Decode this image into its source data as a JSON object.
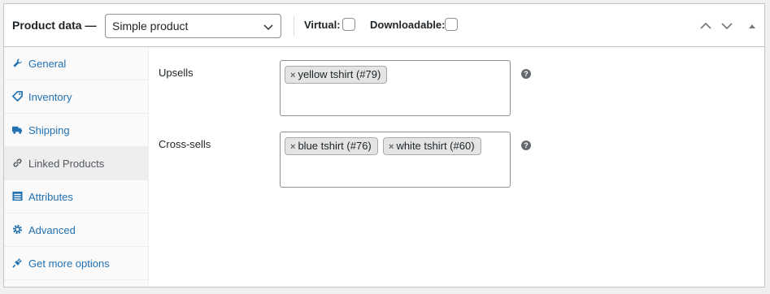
{
  "header": {
    "title": "Product data —",
    "product_type": "Simple product",
    "virtual_label": "Virtual:",
    "virtual_checked": false,
    "downloadable_label": "Downloadable:",
    "downloadable_checked": false
  },
  "tabs": [
    {
      "label": "General",
      "icon": "wrench-icon",
      "active": false
    },
    {
      "label": "Inventory",
      "icon": "tag-icon",
      "active": false
    },
    {
      "label": "Shipping",
      "icon": "truck-icon",
      "active": false
    },
    {
      "label": "Linked Products",
      "icon": "link-icon",
      "active": true
    },
    {
      "label": "Attributes",
      "icon": "list-icon",
      "active": false
    },
    {
      "label": "Advanced",
      "icon": "gear-icon",
      "active": false
    },
    {
      "label": "Get more options",
      "icon": "plug-icon",
      "active": false
    }
  ],
  "fields": {
    "upsells": {
      "label": "Upsells",
      "tags": [
        "yellow tshirt (#79)"
      ]
    },
    "crosssells": {
      "label": "Cross-sells",
      "tags": [
        "blue tshirt (#76)",
        "white tshirt (#60)"
      ]
    }
  },
  "help_symbol": "?",
  "remove_symbol": "×",
  "colors": {
    "link": "#2271b1",
    "active_tab_bg": "#eeeeee",
    "border": "#c3c4c7"
  }
}
